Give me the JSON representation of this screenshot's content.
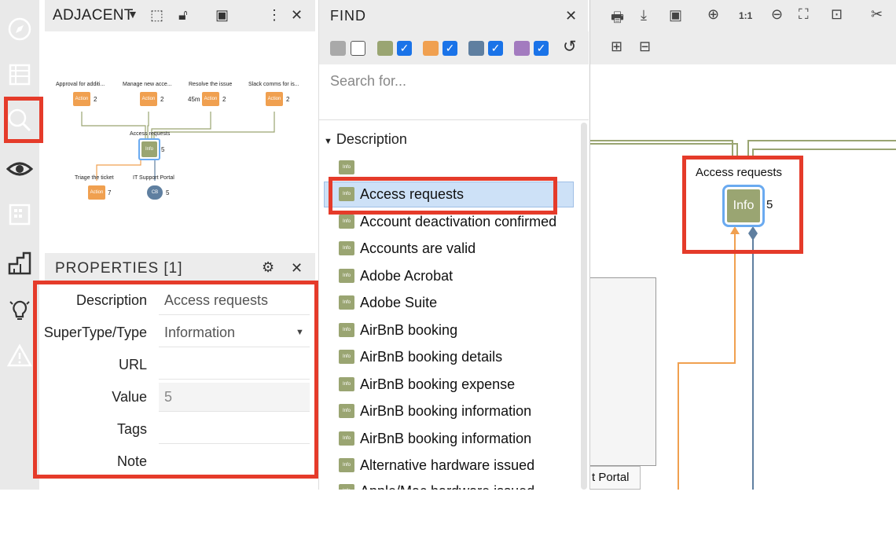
{
  "adjacent_panel": {
    "title": "ADJACENT",
    "nodes": {
      "approval": {
        "label": "Approval for additi...",
        "type": "Action",
        "count": "2"
      },
      "manage": {
        "label": "Manage new acce...",
        "type": "Action",
        "count": "2"
      },
      "resolve": {
        "label": "Resolve the issue",
        "type": "Action",
        "count": "2",
        "duration": "45m"
      },
      "slack": {
        "label": "Slack comms for is...",
        "type": "Action",
        "count": "2"
      },
      "center": {
        "label": "Access requests",
        "type": "Info",
        "count": "5"
      },
      "triage": {
        "label": "Triage the ticket",
        "type": "Action",
        "count": "7"
      },
      "portal": {
        "label": "IT Support Portal",
        "type": "CB",
        "count": "5"
      }
    }
  },
  "properties_panel": {
    "title": "PROPERTIES [1]",
    "rows": [
      {
        "label": "Description",
        "value": "Access requests"
      },
      {
        "label": "SuperType/Type",
        "value": "Information"
      },
      {
        "label": "URL",
        "value": ""
      },
      {
        "label": "Value",
        "value": "5"
      },
      {
        "label": "Tags",
        "value": ""
      },
      {
        "label": "Note",
        "value": ""
      }
    ]
  },
  "find_panel": {
    "title": "FIND",
    "search_placeholder": "Search for...",
    "group_label": "Description",
    "item_icon_label": "Info",
    "results": [
      "",
      "Access requests",
      "Account deactivation confirmed",
      "Accounts are valid",
      "Adobe Acrobat",
      "Adobe Suite",
      "AirBnB booking",
      "AirBnB booking details",
      "AirBnB booking expense",
      "AirBnB booking information",
      "AirBnB booking information",
      "Alternative hardware issued",
      "Apple/Mac hardware issued"
    ],
    "selected_index": 1,
    "filters": [
      {
        "color": "#a9a9a9",
        "checked": false
      },
      {
        "color": "#9aa572",
        "checked": true
      },
      {
        "color": "#f0a050",
        "checked": true
      },
      {
        "color": "#5f7fa0",
        "checked": true
      },
      {
        "color": "#a37bbf",
        "checked": true
      }
    ]
  },
  "canvas": {
    "node_label": "Access requests",
    "node_type": "Info",
    "node_count": "5",
    "portal_label": "t Portal",
    "zoom_reset_label": "1:1"
  },
  "colors": {
    "highlight": "#e53b2a",
    "info": "#9aa572",
    "action": "#f0a050",
    "selection": "#cde1f7"
  }
}
